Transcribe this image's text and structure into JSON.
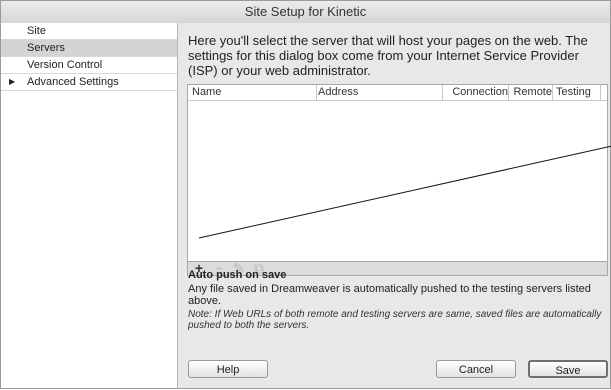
{
  "window": {
    "title": "Site Setup for Kinetic"
  },
  "sidebar": {
    "items": [
      {
        "label": "Site"
      },
      {
        "label": "Servers"
      },
      {
        "label": "Version Control"
      },
      {
        "label": "Advanced Settings",
        "arrow": "▶"
      }
    ]
  },
  "content": {
    "description": "Here you'll select the server that will host your pages on the web. The settings for this dialog box come from your Internet Service Provider (ISP) or your web administrator.",
    "table": {
      "columns": [
        "Name",
        "Address",
        "Connection",
        "Remote",
        "Testing"
      ]
    },
    "toolbar": {
      "add": "+",
      "remove": "−",
      "edit": "✎",
      "duplicate": "⧉"
    },
    "auto_push": {
      "title": "Auto push on save",
      "text": "Any file saved in Dreamweaver is automatically pushed to the testing servers listed above.",
      "note": "Note: If Web URLs of both remote and testing servers are same, saved files are automatically pushed to both the servers."
    }
  },
  "buttons": {
    "help": "Help",
    "cancel": "Cancel",
    "save": "Save"
  }
}
